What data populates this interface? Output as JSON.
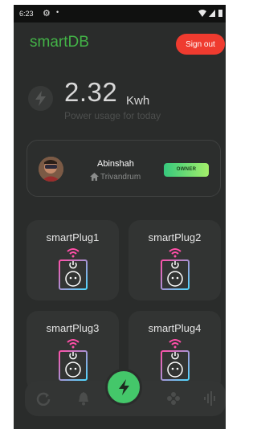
{
  "status_bar": {
    "time": "6:23",
    "icons": [
      "gear-icon",
      "dot-icon",
      "wifi-icon",
      "signal-icon",
      "battery-icon"
    ]
  },
  "header": {
    "title": "smartDB",
    "signout_label": "Sign out"
  },
  "usage": {
    "value": "2.32",
    "unit": "Kwh",
    "caption": "Power usage for today"
  },
  "user": {
    "name": "Abinshah",
    "location": "Trivandrum",
    "role_badge": "OWNER"
  },
  "plugs": [
    {
      "name": "smartPlug1"
    },
    {
      "name": "smartPlug2"
    },
    {
      "name": "smartPlug3"
    },
    {
      "name": "smartPlug4"
    }
  ],
  "bottom_nav": {
    "items": [
      "refresh-icon",
      "bell-icon",
      "power-icon",
      "gamepad-icon",
      "waveform-icon"
    ]
  },
  "colors": {
    "background": "#2a2c2b",
    "accent_green": "#43b347",
    "signout_red": "#ef3b2f",
    "fab_green": "#44c76a"
  }
}
